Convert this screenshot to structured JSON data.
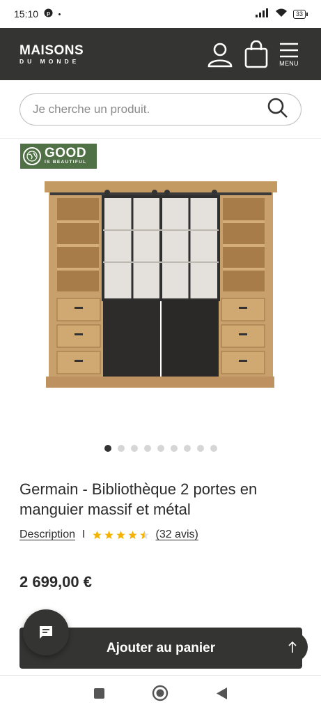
{
  "status": {
    "time": "15:10",
    "battery": "33"
  },
  "header": {
    "logo_main": "MAISONS",
    "logo_sub": "DU MONDE",
    "menu_label": "MENU"
  },
  "search": {
    "placeholder": "Je cherche un produit."
  },
  "badge": {
    "line1": "GOOD",
    "line2": "IS BEAUTIFUL"
  },
  "carousel": {
    "count": 9,
    "active": 0
  },
  "product": {
    "title": "Germain - Bibliothèque 2 portes en manguier massif et métal",
    "description_link": "Description",
    "separator": "I",
    "rating": 4.5,
    "reviews": "(32 avis)",
    "price": "2 699,00 €"
  },
  "cta": {
    "add_to_cart": "Ajouter au panier"
  },
  "colors": {
    "dark": "#343433",
    "badge_green": "#4f7145",
    "star": "#f5b301"
  }
}
